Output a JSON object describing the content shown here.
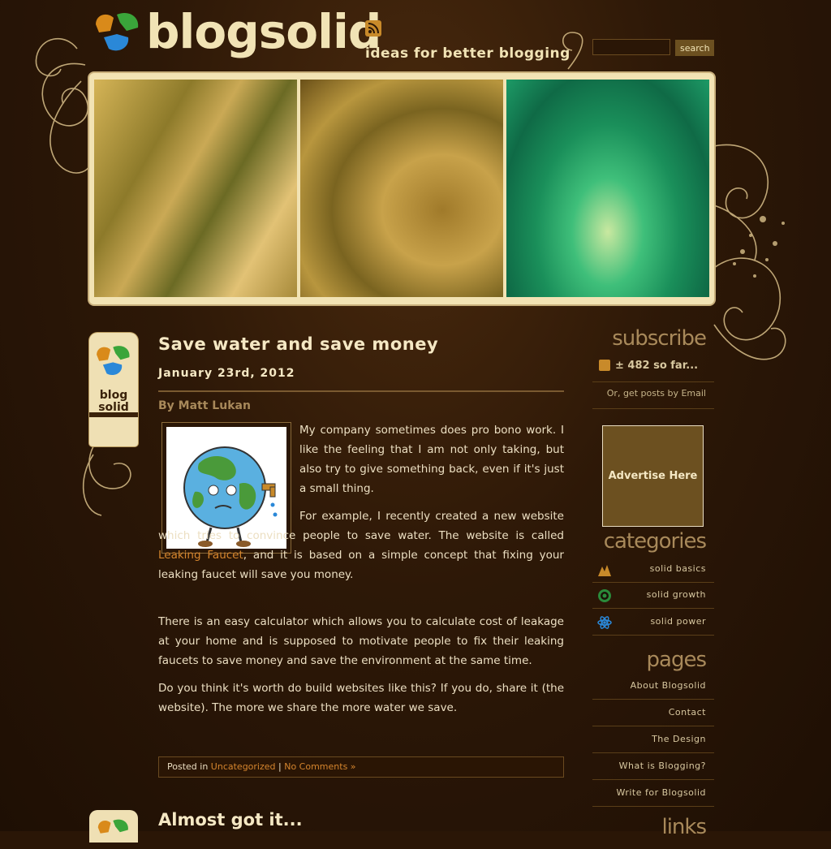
{
  "header": {
    "logo_text": "blogsolid",
    "tagline": "ideas for better blogging",
    "search": {
      "placeholder": "",
      "button_label": "search"
    }
  },
  "badge": {
    "label_line1": "blog",
    "label_line2": "solid"
  },
  "post": {
    "title": "Save water and save money",
    "date": "January 23rd, 2012",
    "author": "By Matt Lukan",
    "p1": "My company sometimes does pro bono work. I like the feeling that I am not only taking, but also try to give something back, even if it's just a small thing.",
    "p2_before": "For example, I recently created a new website which tries to convince people to save water. The website is called ",
    "p2_link": "Leaking Faucet",
    "p2_after": ", and it is based on a simple concept that fixing your leaking faucet will save you money.",
    "p3": "There is an easy calculator which allows you to calculate cost of leakage at your home and is supposed to motivate people to fix their leaking faucets to save money and save the environment at the same time.",
    "p4": "Do you think it's worth do build websites like this? If you do, share it (the website). The more we share the more water we save.",
    "meta_prefix": "Posted in ",
    "meta_category": "Uncategorized",
    "meta_sep": " | ",
    "meta_comments": "No Comments »"
  },
  "post2": {
    "title": "Almost got it..."
  },
  "sidebar": {
    "subscribe_heading": "subscribe",
    "subscriber_count": "± 482 so far...",
    "email_text": "Or, get posts by Email",
    "ad_text": "Advertise Here",
    "categories_heading": "categories",
    "categories": [
      {
        "label": "solid basics",
        "icon": "mountain-icon"
      },
      {
        "label": "solid growth",
        "icon": "target-icon"
      },
      {
        "label": "solid power",
        "icon": "atom-icon"
      }
    ],
    "pages_heading": "pages",
    "pages": [
      "About Blogsolid",
      "Contact",
      "The Design",
      "What is Blogging?",
      "Write for Blogsolid"
    ],
    "links_heading": "links"
  },
  "colors": {
    "background": "#2a1606",
    "accent": "#d5852d",
    "text": "#ecdfc2",
    "muted": "#a8895a"
  }
}
